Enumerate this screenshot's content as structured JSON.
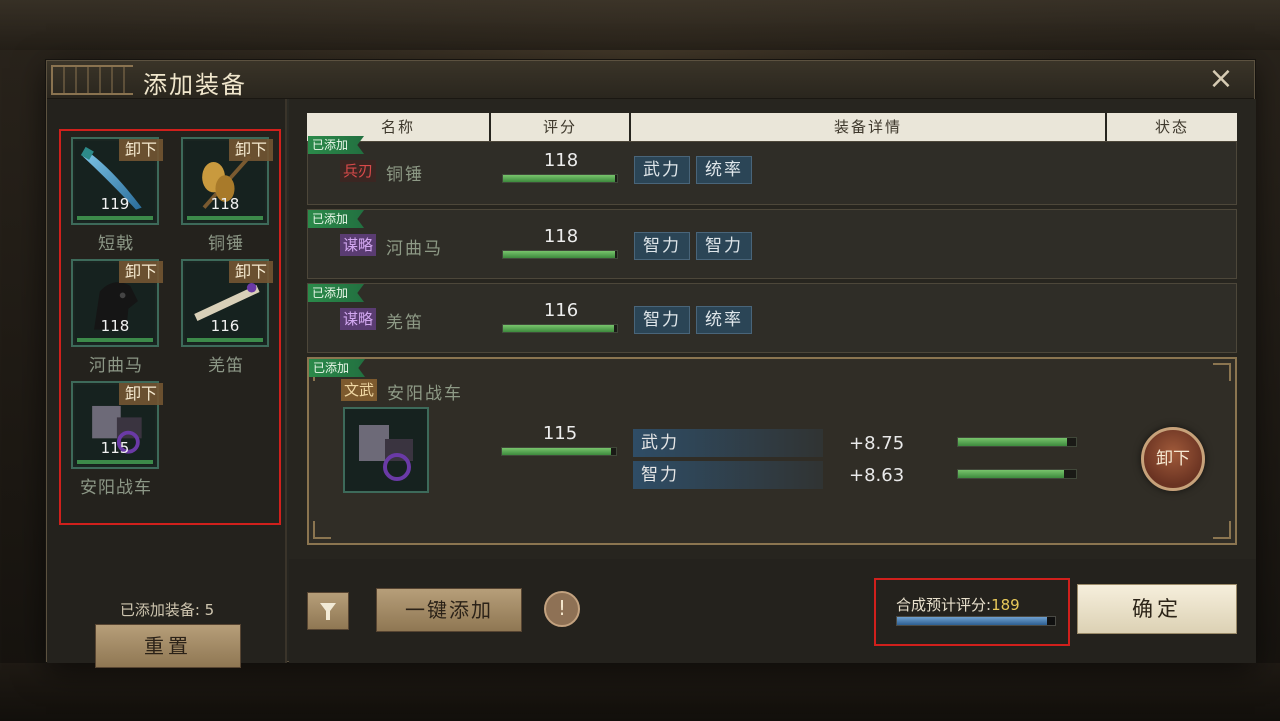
{
  "dialog": {
    "title": "添加装备",
    "close_icon": "×"
  },
  "left": {
    "slots": [
      {
        "name": "短戟",
        "score": "119",
        "unequip": "卸下",
        "icon": "halberd-icon"
      },
      {
        "name": "铜锤",
        "score": "118",
        "unequip": "卸下",
        "icon": "bronze-hammer-icon"
      },
      {
        "name": "河曲马",
        "score": "118",
        "unequip": "卸下",
        "icon": "horse-icon"
      },
      {
        "name": "羌笛",
        "score": "116",
        "unequip": "卸下",
        "icon": "flute-icon"
      },
      {
        "name": "安阳战车",
        "score": "115",
        "unequip": "卸下",
        "icon": "war-chariot-icon"
      }
    ],
    "added_count": "已添加装备: 5",
    "reset_label": "重置"
  },
  "table": {
    "headers": [
      "名称",
      "评分",
      "装备详情",
      "状态"
    ],
    "rows": [
      {
        "badge": "已添加",
        "type": "兵刃",
        "name": "铜锤",
        "score": "118",
        "score_fill": 0.98,
        "attrs": [
          "武力",
          "统率"
        ]
      },
      {
        "badge": "已添加",
        "type": "谋略",
        "name": "河曲马",
        "score": "118",
        "score_fill": 0.98,
        "attrs": [
          "智力",
          "智力"
        ]
      },
      {
        "badge": "已添加",
        "type": "谋略",
        "name": "羌笛",
        "score": "116",
        "score_fill": 0.97,
        "attrs": [
          "智力",
          "统率"
        ]
      },
      {
        "badge": "已添加",
        "type": "文武",
        "name": "安阳战车",
        "score": "115",
        "score_fill": 0.96,
        "stats": [
          {
            "label": "武力",
            "value": "+8.75",
            "fill": 0.92
          },
          {
            "label": "智力",
            "value": "+8.63",
            "fill": 0.9
          }
        ],
        "unequip": "卸下"
      }
    ]
  },
  "bottom": {
    "filter_icon": "filter-icon",
    "onekey_label": "一键添加",
    "info_label": "!",
    "predict_label": "合成预计评分:",
    "predict_value": "189",
    "predict_fill": 0.95,
    "confirm_label": "确定"
  },
  "colors": {
    "accent_green": "#3d8a3d",
    "badge_green": "#2b8a4a",
    "highlight_red": "#d0201c",
    "bar_blue": "#2d5f91"
  }
}
